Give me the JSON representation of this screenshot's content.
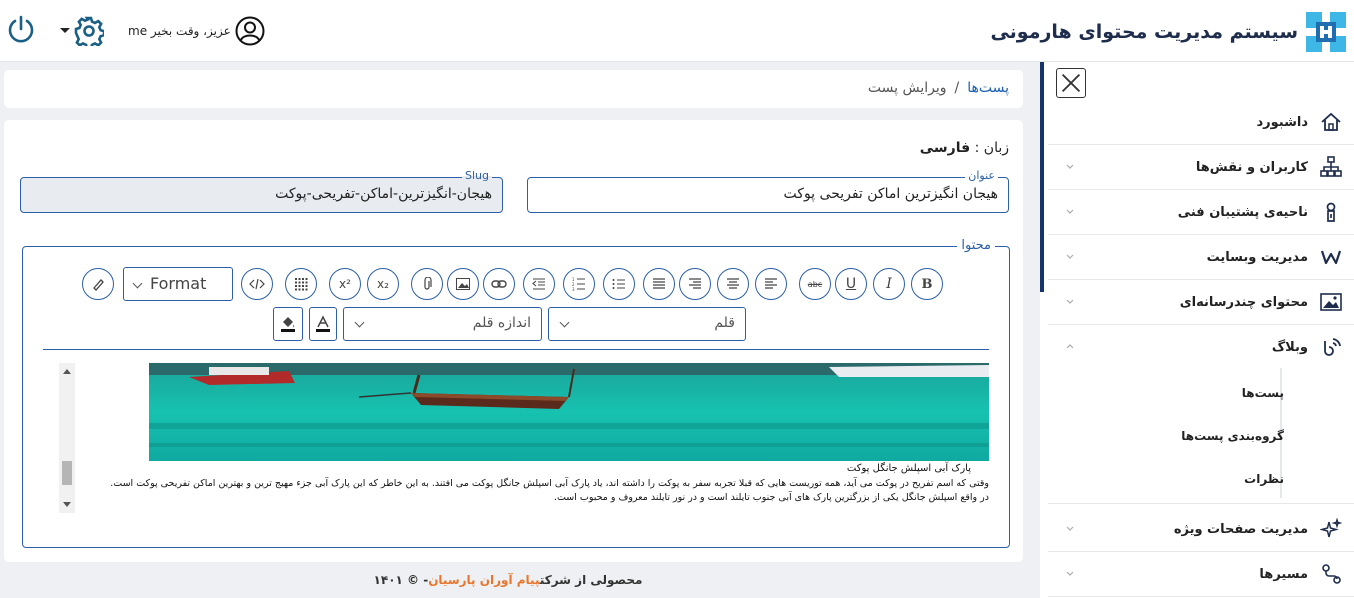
{
  "header": {
    "app_title": "سیستم مدیریت محتوای هارمونی",
    "greeting": "me عزیز، وقت بخیر",
    "icons": [
      "logo-icon",
      "power-icon",
      "gear-icon",
      "user-avatar-icon"
    ]
  },
  "breadcrumb": {
    "parent": "پست‌ها",
    "separator": "/",
    "current": "ویرایش پست"
  },
  "form": {
    "language_label": "زبان :",
    "language_value": "فارسی",
    "title_label": "عنوان",
    "title_value": "هیجان انگیزترین اماکن تفریحی پوکت",
    "slug_label": "Slug",
    "slug_value": "هیجان-انگیزترین-اماکن-تفریحی-پوکت",
    "content_label": "محتوا"
  },
  "toolbar": {
    "format_label": "Format",
    "font_label": "قلم",
    "font_size_label": "اندازه قلم",
    "bold": "B",
    "italic": "I",
    "underline": "U",
    "strike": "abc",
    "superscript": "x²",
    "subscript": "x₂"
  },
  "editor": {
    "caption_title": "پارک آبی اسپلش جانگل پوکت",
    "caption_body": "وقتی که اسم تفریح در پوکت می آید، همه توریست هایی که قبلا تجربه سفر به پوکت را داشته اند، یاد پارک آبی اسپلش جانگل پوکت می افتند. به این خاطر که این پارک آبی جزء مهیج ترین و بهترین اماکن تفریحی پوکت است. در واقع اسپلش جانگل یکی از بزرگترین پارک های آبی جنوب تایلند است و در نور تایلند معروف و محبوب است."
  },
  "sidebar": {
    "items": [
      {
        "label": "داشبورد",
        "icon": "home-icon"
      },
      {
        "label": "کاربران و نقش‌ها",
        "icon": "users-hierarchy-icon"
      },
      {
        "label": "ناحیه‌ی پشتیبان فنی",
        "icon": "support-icon"
      },
      {
        "label": "مدیریت وبسایت",
        "icon": "website-icon"
      },
      {
        "label": "محتوای چندرسانه‌ای",
        "icon": "media-icon"
      },
      {
        "label": "وبلاگ",
        "icon": "blog-icon"
      },
      {
        "label": "مدیریت صفحات ویژه",
        "icon": "sparkle-icon"
      },
      {
        "label": "مسیرها",
        "icon": "routes-icon"
      }
    ],
    "blog_sub": [
      "پست‌ها",
      "گروه‌بندی پست‌ها",
      "نظرات"
    ]
  },
  "footer": {
    "prefix": "محصولی از شرکت",
    "company": "پیام آوران پارسیان",
    "suffix": "- © ۱۴۰۱"
  },
  "colors": {
    "accent": "#2c5fa8",
    "brand_dark": "#16336b",
    "link": "#1a5fb4",
    "footer_brand": "#e8762c"
  }
}
